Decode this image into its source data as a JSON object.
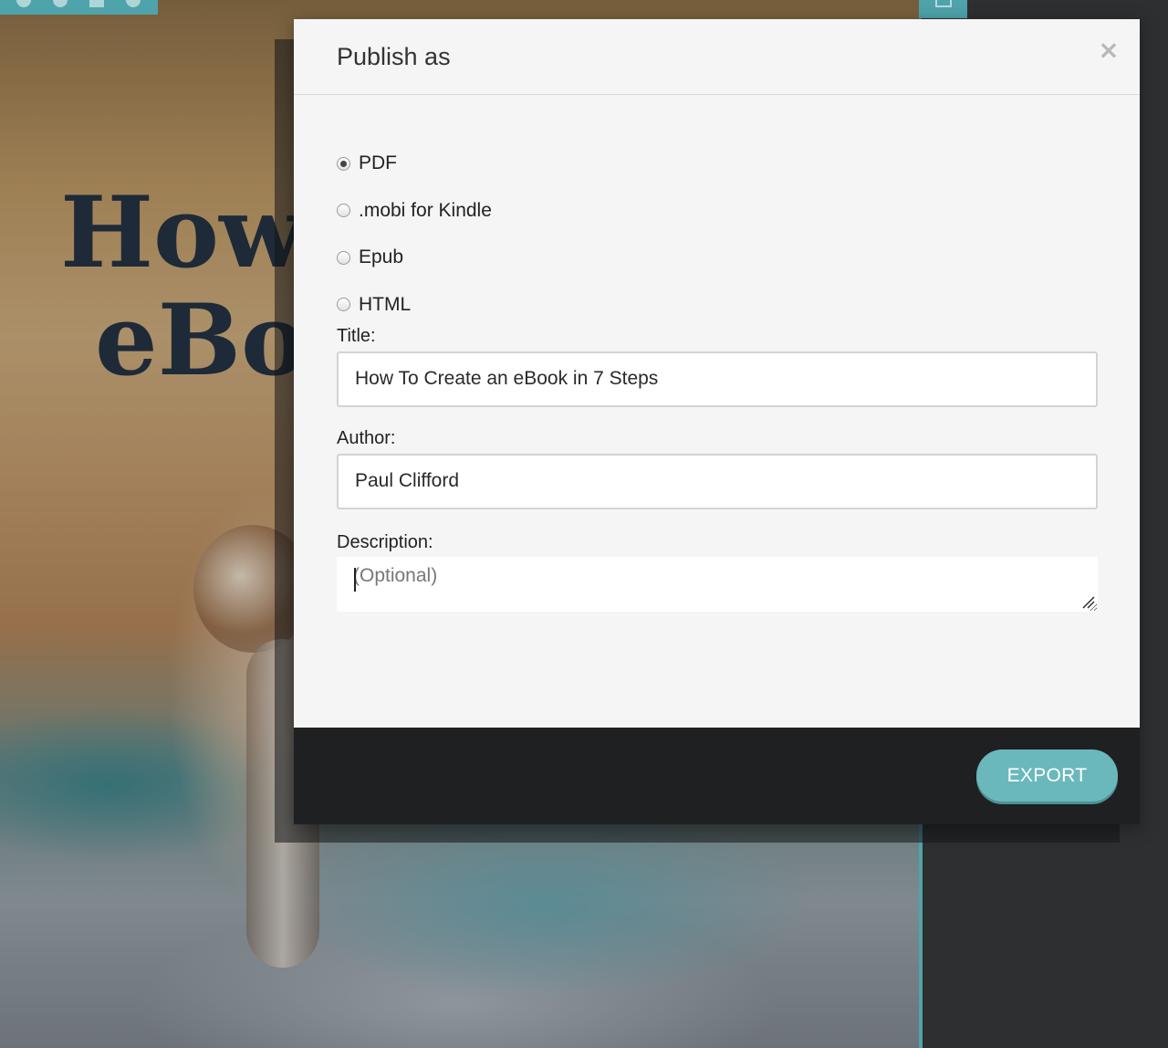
{
  "background": {
    "cover_title_line1": "How",
    "cover_title_line2": "eBoo"
  },
  "dialog": {
    "title": "Publish as",
    "close_symbol": "×",
    "formats": [
      {
        "label": "PDF",
        "selected": true
      },
      {
        "label": ".mobi for Kindle",
        "selected": false
      },
      {
        "label": "Epub",
        "selected": false
      },
      {
        "label": "HTML",
        "selected": false
      }
    ],
    "title_field": {
      "label": "Title:",
      "value": "How To Create an eBook in 7 Steps"
    },
    "author_field": {
      "label": "Author:",
      "value": "Paul Clifford"
    },
    "description_field": {
      "label": "Description:",
      "placeholder": "(Optional)",
      "value": ""
    },
    "export_label": "EXPORT"
  },
  "colors": {
    "accent": "#6ab8bc",
    "footer": "#1f2022",
    "dialog_background": "#f5f5f5"
  },
  "icons": [
    "close-icon",
    "radio-checked-icon",
    "radio-unchecked-icon",
    "resize-grip-icon"
  ]
}
